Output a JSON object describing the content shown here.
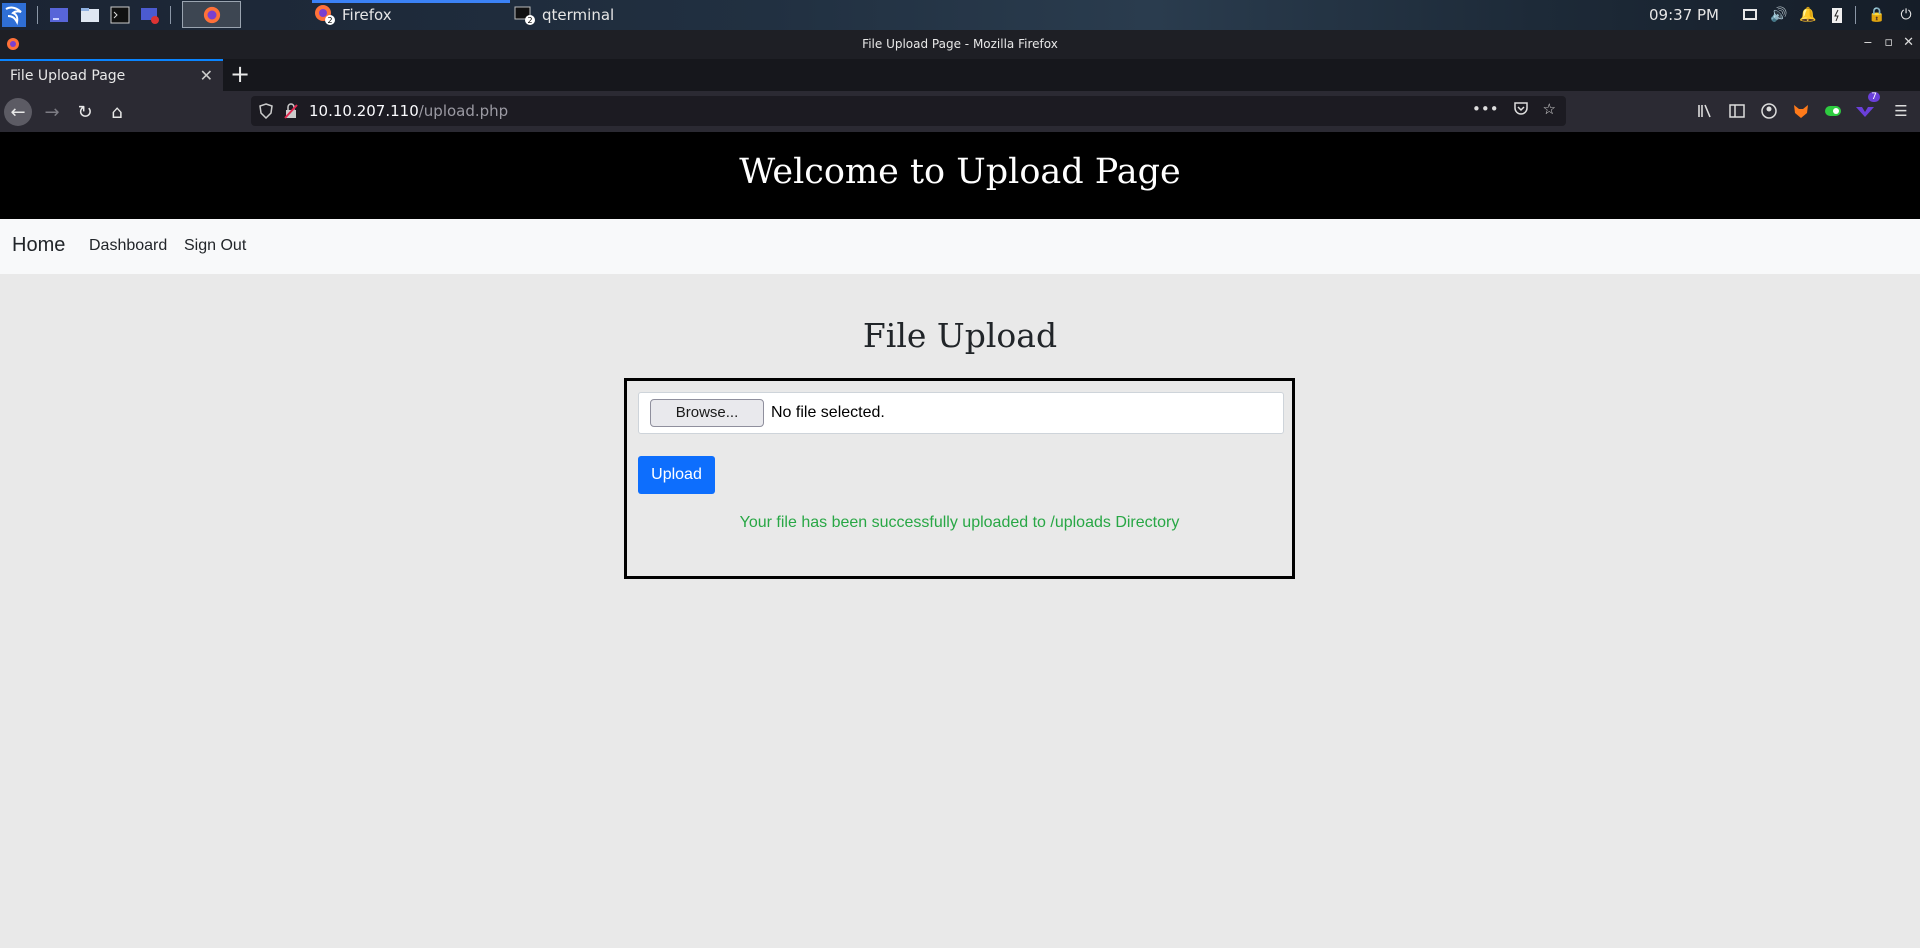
{
  "taskbar": {
    "tasks": [
      {
        "label": "Firefox",
        "badge": "2",
        "active": true
      },
      {
        "label": "qterminal",
        "badge": "2",
        "active": false
      }
    ],
    "clock": "09:37 PM",
    "icons": [
      "kali-menu-icon",
      "show-desktop-icon",
      "file-manager-icon",
      "terminal-icon",
      "screenshot-icon",
      "firefox-icon"
    ],
    "tray_icons": [
      "monitor-icon",
      "volume-icon",
      "bell-icon",
      "battery-icon",
      "lock-icon",
      "power-icon"
    ]
  },
  "window": {
    "title": "File Upload Page - Mozilla Firefox"
  },
  "browser": {
    "tab_title": "File Upload Page",
    "url_host": "10.10.207.110",
    "url_path": "/upload.php",
    "extension_badge": "7"
  },
  "page": {
    "hero_title": "Welcome to Upload Page",
    "nav": {
      "brand": "Home",
      "links": [
        "Dashboard",
        "Sign Out"
      ]
    },
    "heading": "File Upload",
    "browse_label": "Browse...",
    "file_status": "No file selected.",
    "upload_label": "Upload",
    "success_message": "Your file has been successfully uploaded to /uploads Directory",
    "success_color": "#28a745",
    "button_color": "#0d6efd"
  }
}
